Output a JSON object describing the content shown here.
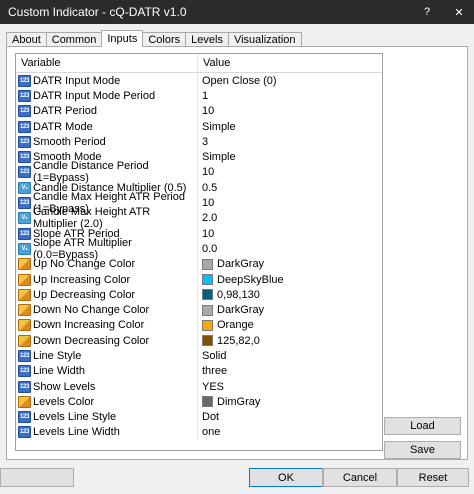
{
  "window": {
    "title": "Custom Indicator - cQ-DATR v1.0",
    "help_label": "?",
    "close_label": "✕"
  },
  "tabs": [
    {
      "label": "About"
    },
    {
      "label": "Common"
    },
    {
      "label": "Inputs",
      "active": true
    },
    {
      "label": "Colors"
    },
    {
      "label": "Levels"
    },
    {
      "label": "Visualization"
    }
  ],
  "grid": {
    "header_variable": "Variable",
    "header_value": "Value",
    "rows": [
      {
        "var": "DATR Input Mode",
        "val": "Open Close (0)",
        "icon": "int-icon"
      },
      {
        "var": "DATR Input Mode Period",
        "val": "1",
        "icon": "int-icon"
      },
      {
        "var": "DATR Period",
        "val": "10",
        "icon": "int-icon"
      },
      {
        "var": "DATR Mode",
        "val": "Simple",
        "icon": "int-icon"
      },
      {
        "var": "Smooth Period",
        "val": "3",
        "icon": "int-icon"
      },
      {
        "var": "Smooth Mode",
        "val": "Simple",
        "icon": "int-icon"
      },
      {
        "var": "Candle Distance Period (1=Bypass)",
        "val": "10",
        "icon": "int-icon"
      },
      {
        "var": "Candle Distance Multiplier (0.5)",
        "val": "0.5",
        "icon": "double-icon"
      },
      {
        "var": "Candle Max Height ATR Period (1=Bypass)",
        "val": "10",
        "icon": "int-icon"
      },
      {
        "var": "Candle Max Height ATR Multiplier (2.0)",
        "val": "2.0",
        "icon": "double-icon"
      },
      {
        "var": "Slope ATR Period",
        "val": "10",
        "icon": "int-icon"
      },
      {
        "var": "Slope ATR Multiplier (0.0=Bypass)",
        "val": "0.0",
        "icon": "double-icon"
      },
      {
        "var": "Up No Change Color",
        "val": "DarkGray",
        "icon": "color-icon",
        "color": "#a9a9a9"
      },
      {
        "var": "Up Increasing Color",
        "val": "DeepSkyBlue",
        "icon": "color-icon",
        "color": "#00bfff"
      },
      {
        "var": "Up Decreasing Color",
        "val": "0,98,130",
        "icon": "color-icon",
        "color": "#006282"
      },
      {
        "var": "Down No Change Color",
        "val": "DarkGray",
        "icon": "color-icon",
        "color": "#a9a9a9"
      },
      {
        "var": "Down Increasing Color",
        "val": "Orange",
        "icon": "color-icon",
        "color": "#ffa500"
      },
      {
        "var": "Down Decreasing Color",
        "val": "125,82,0",
        "icon": "color-icon",
        "color": "#7d5200"
      },
      {
        "var": "Line Style",
        "val": "Solid",
        "icon": "int-icon"
      },
      {
        "var": "Line Width",
        "val": "three",
        "icon": "int-icon"
      },
      {
        "var": "Show Levels",
        "val": "YES",
        "icon": "int-icon"
      },
      {
        "var": "Levels Color",
        "val": "DimGray",
        "icon": "color-icon",
        "color": "#696969"
      },
      {
        "var": "Levels Line Style",
        "val": "Dot",
        "icon": "int-icon"
      },
      {
        "var": "Levels Line Width",
        "val": "one",
        "icon": "int-icon"
      }
    ]
  },
  "buttons": {
    "load": "Load",
    "save": "Save",
    "ok": "OK",
    "cancel": "Cancel",
    "reset": "Reset"
  }
}
